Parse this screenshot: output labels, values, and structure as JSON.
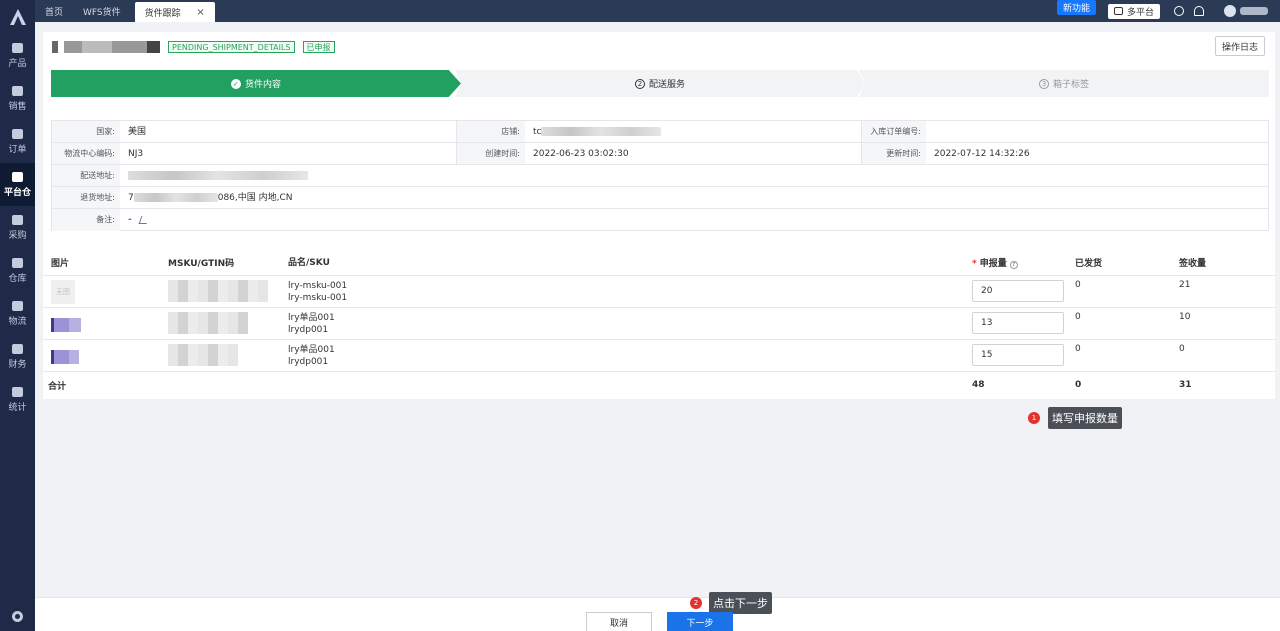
{
  "top_tabs": [
    {
      "label": "首页"
    },
    {
      "label": "WFS货件"
    },
    {
      "label": "货件跟踪"
    }
  ],
  "top_right": {
    "new_feature": "新功能",
    "multi_platform": "多平台"
  },
  "sidebar": {
    "items": [
      {
        "label": "产品"
      },
      {
        "label": "销售"
      },
      {
        "label": "订单"
      },
      {
        "label": "平台仓"
      },
      {
        "label": "采购"
      },
      {
        "label": "仓库"
      },
      {
        "label": "物流"
      },
      {
        "label": "财务"
      },
      {
        "label": "统计"
      }
    ]
  },
  "header": {
    "status_tag": "PENDING_SHIPMENT_DETAILS",
    "declared_tag": "已申报",
    "log_button": "操作日志"
  },
  "steps": [
    {
      "label": "货件内容"
    },
    {
      "num": "2",
      "label": "配送服务"
    },
    {
      "num": "3",
      "label": "箱子标签"
    }
  ],
  "info": {
    "country_label": "国家:",
    "country_value": "美国",
    "store_label": "店铺:",
    "store_value": "tc",
    "inbound_label": "入库订单编号:",
    "inbound_value": "",
    "center_label": "物流中心编码:",
    "center_value": "NJ3",
    "created_label": "创建时间:",
    "created_value": "2022-06-23 03:02:30",
    "updated_label": "更新时间:",
    "updated_value": "2022-07-12 14:32:26",
    "ship_addr_label": "配送地址:",
    "return_addr_label": "退货地址:",
    "return_addr_prefix": "7",
    "return_addr_value": "086,中国 内地,CN",
    "remark_label": "备注:",
    "remark_value": "-"
  },
  "table": {
    "headers": {
      "image": "图片",
      "msku": "MSKU/GTIN码",
      "name_sku": "品名/SKU",
      "declared_qty": "申报量",
      "shipped": "已发货",
      "received": "签收量"
    },
    "rows": [
      {
        "image": "无图",
        "name": "lry-msku-001",
        "sku": "lry-msku-001",
        "qty": "20",
        "shipped": "0",
        "received": "21"
      },
      {
        "image": "",
        "name": "lry单品001",
        "sku": "lrydp001",
        "qty": "13",
        "shipped": "0",
        "received": "10"
      },
      {
        "image": "",
        "name": "lry单品001",
        "sku": "lrydp001",
        "qty": "15",
        "shipped": "0",
        "received": "0"
      }
    ],
    "total": {
      "label": "合计",
      "qty": "48",
      "shipped": "0",
      "received": "31"
    }
  },
  "tips": {
    "tip1_num": "1",
    "tip1": "填写申报数量",
    "tip2_num": "2",
    "tip2": "点击下一步"
  },
  "footer": {
    "cancel": "取消",
    "next": "下一步"
  },
  "colors": {
    "sidebar_bg": "#1e2a47",
    "step_done": "#22a061",
    "primary": "#1a73e8",
    "badge": "#e5322d"
  }
}
